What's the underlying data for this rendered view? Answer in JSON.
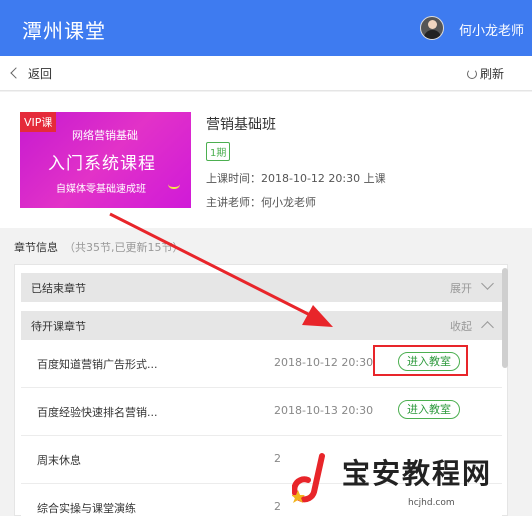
{
  "header": {
    "app_title": "潭州课堂",
    "user_name": "何小龙老师"
  },
  "topbar": {
    "back_label": "返回",
    "refresh_label": "刷新"
  },
  "course": {
    "cover": {
      "badge": "VIP课",
      "line1": "网络营销基础",
      "line2": "入门系统课程",
      "line3": "自媒体零基础速成班"
    },
    "name": "营销基础班",
    "period": "1期",
    "start_time": "上课时间：2018-10-12 20:30 上课",
    "teacher": "主讲老师：何小龙老师"
  },
  "chapters": {
    "label": "章节信息",
    "meta": "（共35节,已更新15节）",
    "groups": [
      {
        "label": "已结束章节",
        "toggle": "展开",
        "state": "collapsed"
      },
      {
        "label": "待开课章节",
        "toggle": "收起",
        "state": "expanded"
      }
    ],
    "rows": [
      {
        "name": "百度知道营销广告形式...",
        "time": "2018-10-12 20:30",
        "action": "进入教室"
      },
      {
        "name": "百度经验快速排名营销...",
        "time": "2018-10-13 20:30",
        "action": "进入教室"
      },
      {
        "name": "周末休息",
        "time": "2",
        "action": ""
      },
      {
        "name": "综合实操与课堂演练",
        "time": "2",
        "action": ""
      }
    ]
  },
  "watermark": {
    "text": "宝安教程网",
    "url": "hcjhd.com"
  },
  "colors": {
    "header_bg": "#3e7bf0",
    "accent_green": "#4caf50",
    "annotation_red": "#e8252a",
    "cover_magenta": "#d01ad8"
  }
}
